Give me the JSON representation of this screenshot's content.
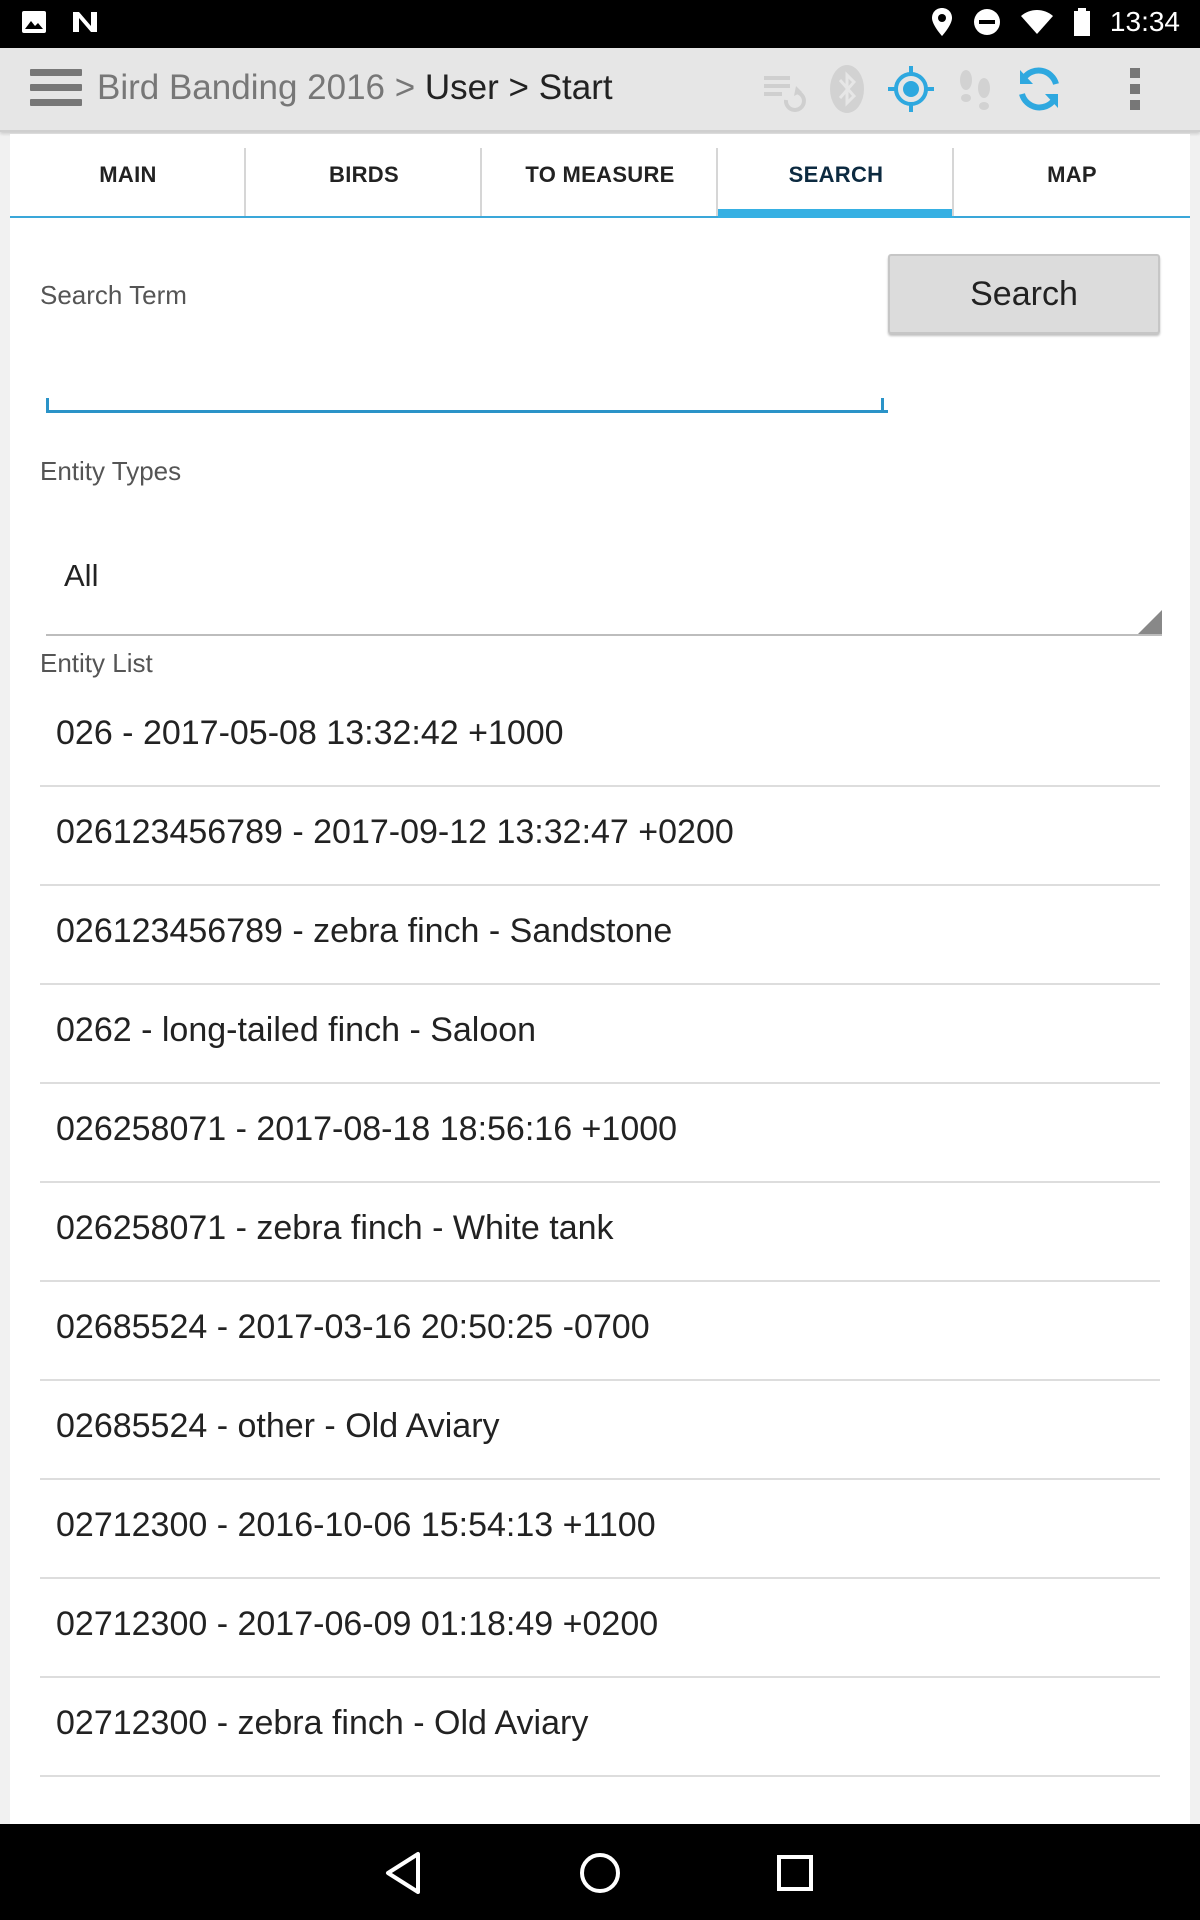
{
  "status_bar": {
    "time": "13:34",
    "icons": [
      "image-icon",
      "n-icon",
      "location-icon",
      "dnd-icon",
      "wifi-icon",
      "battery-icon"
    ]
  },
  "toolbar": {
    "breadcrumb": {
      "app": "Bird Banding 2016",
      "sep1": " > ",
      "user": "User",
      "sep2": " > ",
      "current": "Start"
    },
    "icons": [
      "sync-disabled-icon",
      "bluetooth-icon",
      "gps-target-icon",
      "footprints-icon",
      "refresh-icon",
      "overflow-menu-icon"
    ],
    "accent": "#2ea8df"
  },
  "tabs": [
    {
      "label": "MAIN",
      "active": false
    },
    {
      "label": "BIRDS",
      "active": false
    },
    {
      "label": "TO MEASURE",
      "active": false
    },
    {
      "label": "SEARCH",
      "active": true
    },
    {
      "label": "MAP",
      "active": false
    }
  ],
  "search": {
    "term_label": "Search Term",
    "button_label": "Search",
    "input_value": "",
    "input_placeholder": ""
  },
  "entity_types": {
    "label": "Entity Types",
    "selected": "All"
  },
  "entity_list": {
    "label": "Entity List",
    "items": [
      "026 - 2017-05-08 13:32:42 +1000",
      "026123456789 - 2017-09-12 13:32:47 +0200",
      "026123456789 - zebra finch - Sandstone",
      "0262 - long-tailed finch - Saloon",
      "026258071 - 2017-08-18 18:56:16 +1000",
      "026258071 - zebra finch - White tank",
      "02685524 - 2017-03-16 20:50:25 -0700",
      "02685524 - other - Old Aviary",
      "02712300 - 2016-10-06 15:54:13 +1100",
      "02712300 - 2017-06-09 01:18:49 +0200",
      "02712300 - zebra finch - Old Aviary"
    ]
  },
  "nav_bar": {
    "icons": [
      "back-icon",
      "home-icon",
      "recents-icon"
    ]
  }
}
